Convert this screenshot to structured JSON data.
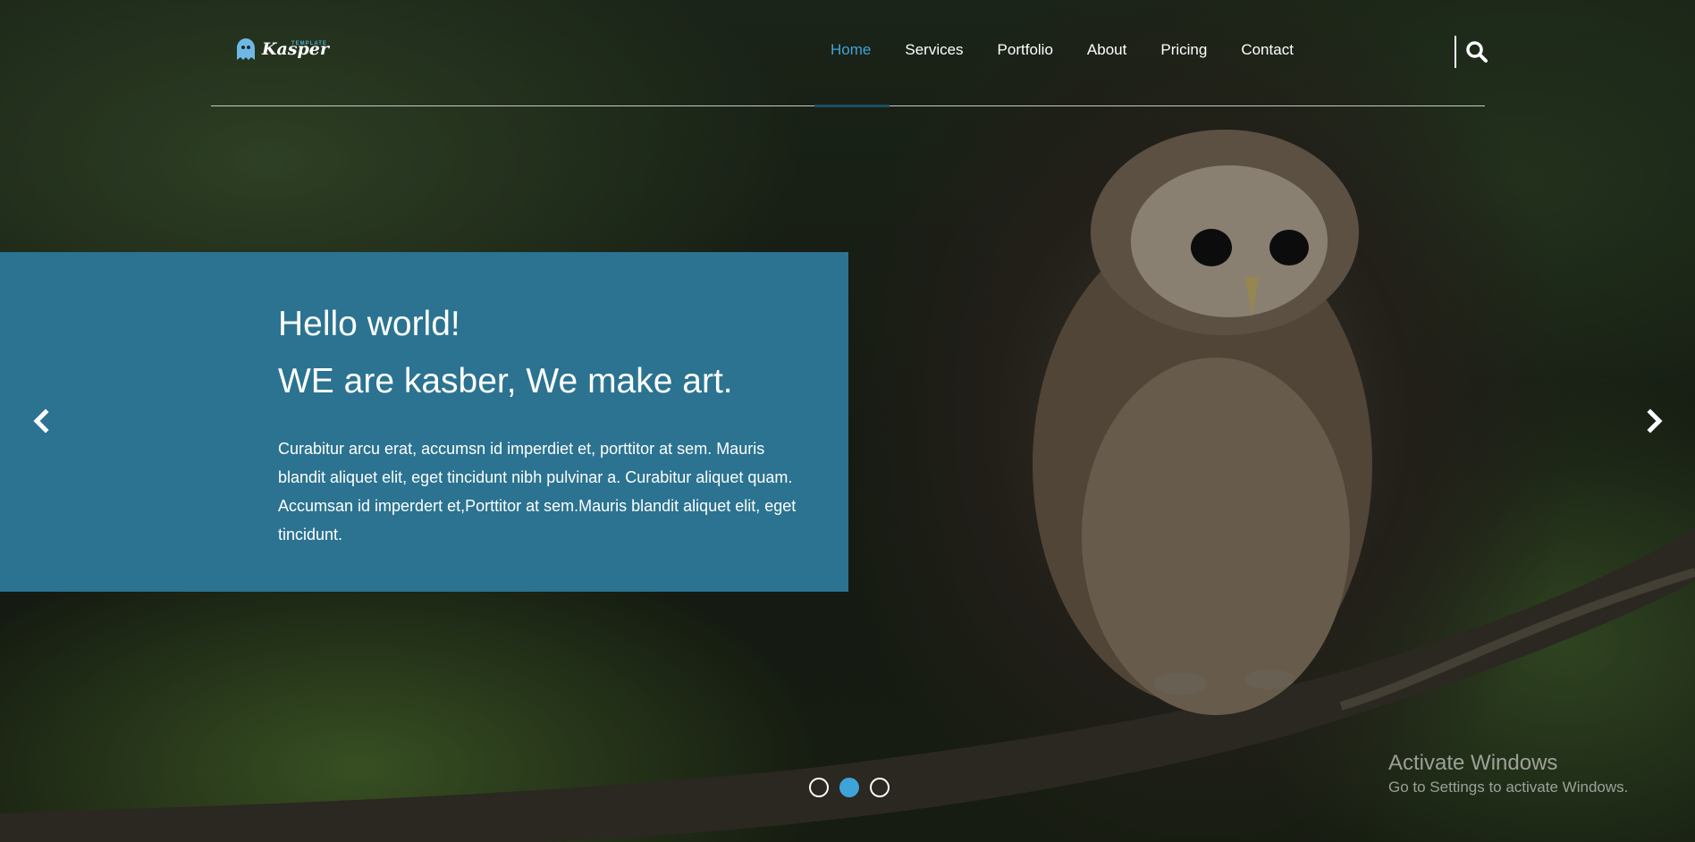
{
  "brand": {
    "name": "Kasper",
    "tagline": "TEMPLATE",
    "accent_color": "#3ea3d8",
    "panel_color": "#2b7391"
  },
  "nav": {
    "items": [
      {
        "label": "Home",
        "active": true
      },
      {
        "label": "Services",
        "active": false
      },
      {
        "label": "Portfolio",
        "active": false
      },
      {
        "label": "About",
        "active": false
      },
      {
        "label": "Pricing",
        "active": false
      },
      {
        "label": "Contact",
        "active": false
      }
    ],
    "search_icon": "search-icon"
  },
  "hero": {
    "title": "Hello world!",
    "subtitle": "WE are kasber, We make art.",
    "text": "Curabitur arcu erat, accumsn id imperdiet et, porttitor at sem. Mauris blandit aliquet elit, eget tincidunt nibh pulvinar a. Curabitur aliquet quam. Accumsan id imperdert et,Porttitor at sem.Mauris blandit aliquet elit, eget tincidunt."
  },
  "carousel": {
    "prev_icon": "chevron-left-icon",
    "next_icon": "chevron-right-icon",
    "slide_count": 3,
    "active_slide": 2
  },
  "watermark": {
    "title": "Activate Windows",
    "subtitle": "Go to Settings to activate Windows."
  }
}
